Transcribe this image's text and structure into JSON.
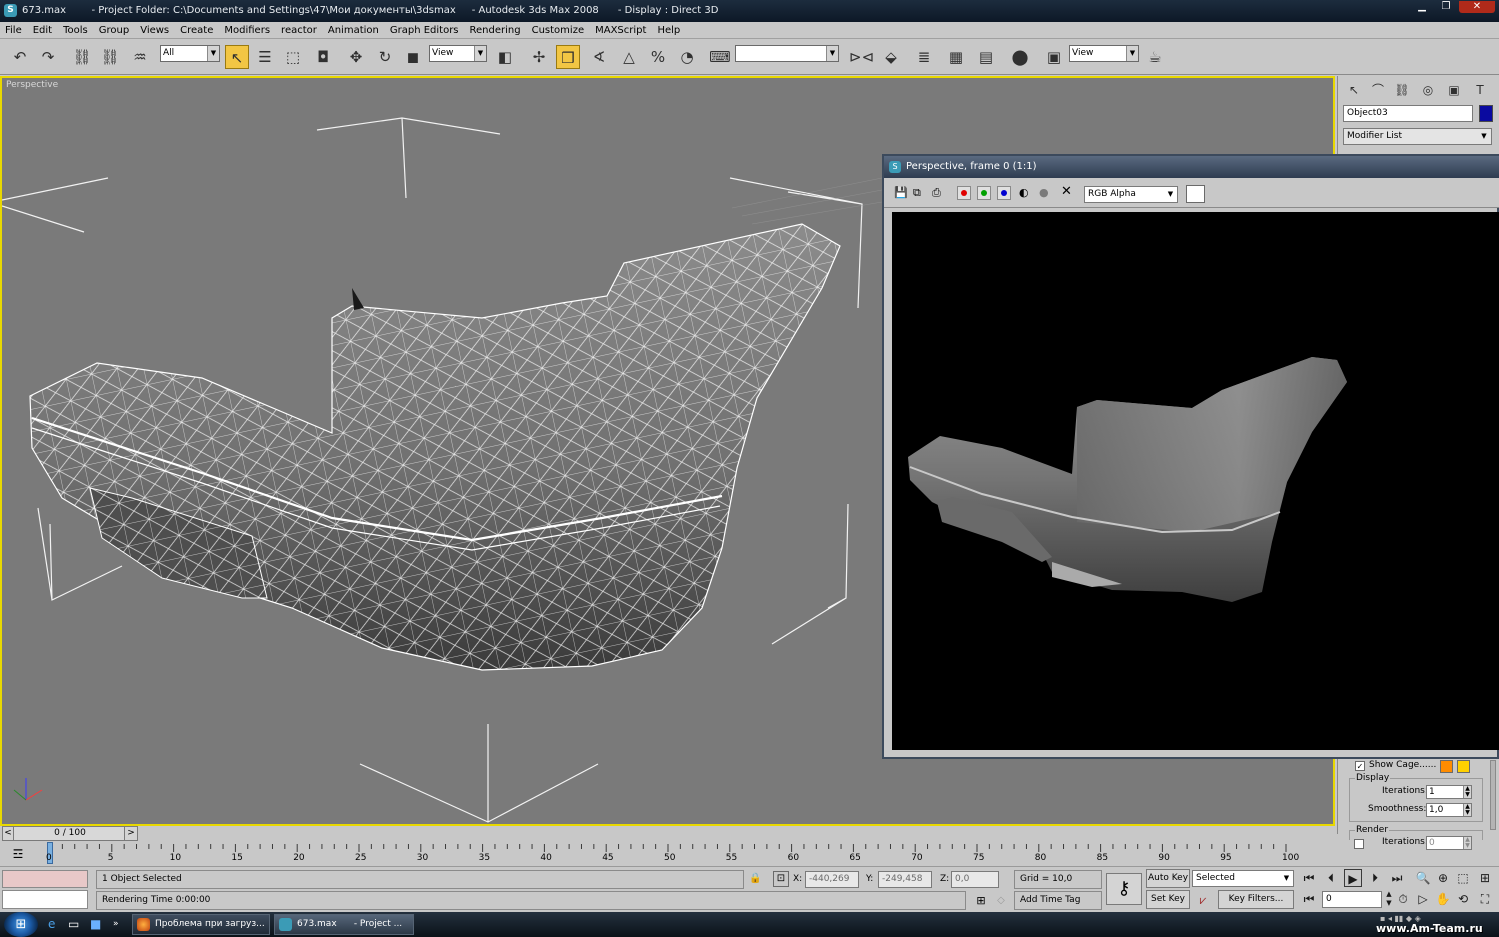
{
  "titlebar": {
    "file": "673.max",
    "project": "- Project Folder: C:\\Documents and Settings\\47\\Мои документы\\3dsmax",
    "app": "- Autodesk 3ds Max 2008",
    "display": "- Display : Direct 3D"
  },
  "menu": [
    "File",
    "Edit",
    "Tools",
    "Group",
    "Views",
    "Create",
    "Modifiers",
    "reactor",
    "Animation",
    "Graph Editors",
    "Rendering",
    "Customize",
    "MAXScript",
    "Help"
  ],
  "toolbar": {
    "selection_filter": "All",
    "reference_coord": "View",
    "named_selection": "",
    "render_view": "View"
  },
  "viewport": {
    "label": "Perspective"
  },
  "command_panel": {
    "object_name": "Object03",
    "modifier_list": "Modifier List",
    "object_color": "#0a0aa0",
    "show_cage": "Show Cage......",
    "display_group": "Display",
    "iterations_label": "Iterations:",
    "iterations_value": "1",
    "smoothness_label": "Smoothness:",
    "smoothness_value": "1,0",
    "render_group": "Render",
    "render_iterations_label": "Iterations:",
    "render_iterations_value": "0"
  },
  "render_window": {
    "title": "Perspective, frame 0 (1:1)",
    "channel": "RGB Alpha"
  },
  "timeline": {
    "slider": "0 / 100",
    "ticks": [
      "0",
      "5",
      "10",
      "15",
      "20",
      "25",
      "30",
      "35",
      "40",
      "45",
      "50",
      "55",
      "60",
      "65",
      "70",
      "75",
      "80",
      "85",
      "90",
      "95",
      "100"
    ]
  },
  "status": {
    "selection": "1 Object Selected",
    "rendering_time": "Rendering Time  0:00:00",
    "x_label": "X:",
    "x_value": "-440,269",
    "y_label": "Y:",
    "y_value": "-249,458",
    "z_label": "Z:",
    "z_value": "0,0",
    "grid": "Grid = 10,0",
    "add_time_tag": "Add Time Tag",
    "auto_key": "Auto Key",
    "set_key": "Set Key",
    "key_mode": "Selected",
    "key_filters": "Key Filters...",
    "frame": "0"
  },
  "taskbar": {
    "task1": "Проблема при загруз...",
    "task2": "673.max",
    "task3": "- Project ...",
    "watermark": "www.Am-Team.ru"
  }
}
